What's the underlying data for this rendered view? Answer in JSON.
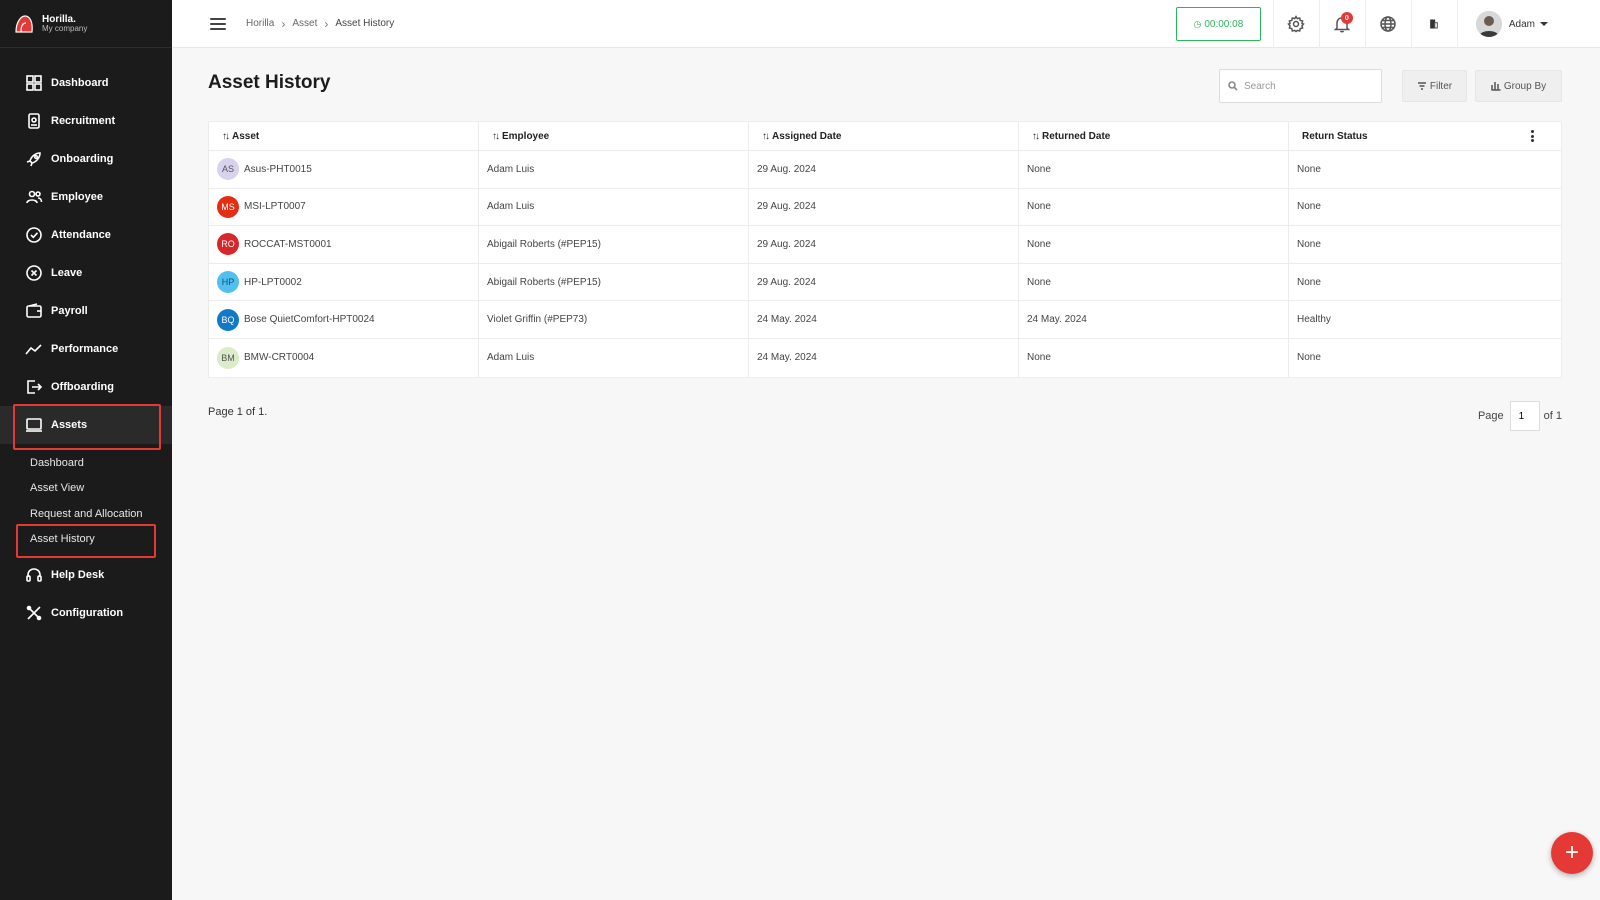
{
  "brand": {
    "name": "Horilla.",
    "company": "My company"
  },
  "sidebar": {
    "items": [
      {
        "label": "Dashboard",
        "icon": "dashboard-icon"
      },
      {
        "label": "Recruitment",
        "icon": "recruitment-icon"
      },
      {
        "label": "Onboarding",
        "icon": "rocket-icon"
      },
      {
        "label": "Employee",
        "icon": "people-icon"
      },
      {
        "label": "Attendance",
        "icon": "check-circle-icon"
      },
      {
        "label": "Leave",
        "icon": "x-circle-icon"
      },
      {
        "label": "Payroll",
        "icon": "wallet-icon"
      },
      {
        "label": "Performance",
        "icon": "trend-icon"
      },
      {
        "label": "Offboarding",
        "icon": "exit-icon"
      },
      {
        "label": "Assets",
        "icon": "laptop-icon",
        "active": true
      }
    ],
    "assets_sub": [
      {
        "label": "Dashboard"
      },
      {
        "label": "Asset View"
      },
      {
        "label": "Request and Allocation"
      },
      {
        "label": "Asset History",
        "active": true
      }
    ],
    "bottom_items": [
      {
        "label": "Help Desk",
        "icon": "headset-icon"
      },
      {
        "label": "Configuration",
        "icon": "tools-icon"
      }
    ]
  },
  "topbar": {
    "breadcrumb": [
      "Horilla",
      "Asset",
      "Asset History"
    ],
    "timer": "00:00:08",
    "notification_count": "0",
    "user_name": "Adam"
  },
  "main": {
    "title": "Asset History",
    "search_placeholder": "Search",
    "filter_label": "Filter",
    "group_by_label": "Group By",
    "columns": [
      "Asset",
      "Employee",
      "Assigned Date",
      "Returned Date",
      "Return Status"
    ],
    "rows": [
      {
        "initials": "AS",
        "avatar_bg": "#d9d2ee",
        "avatar_fg": "#555",
        "asset": "Asus-PHT0015",
        "employee": "Adam Luis",
        "assigned": "29 Aug. 2024",
        "returned": "None",
        "status": "None"
      },
      {
        "initials": "MS",
        "avatar_bg": "#e52d12",
        "avatar_fg": "#fff",
        "asset": "MSI-LPT0007",
        "employee": "Adam Luis",
        "assigned": "29 Aug. 2024",
        "returned": "None",
        "status": "None"
      },
      {
        "initials": "RO",
        "avatar_bg": "#d8262b",
        "avatar_fg": "#fff",
        "asset": "ROCCAT-MST0001",
        "employee": "Abigail Roberts (#PEP15)",
        "assigned": "29 Aug. 2024",
        "returned": "None",
        "status": "None"
      },
      {
        "initials": "HP",
        "avatar_bg": "#4fc0ef",
        "avatar_fg": "#1a4f6b",
        "asset": "HP-LPT0002",
        "employee": "Abigail Roberts (#PEP15)",
        "assigned": "29 Aug. 2024",
        "returned": "None",
        "status": "None"
      },
      {
        "initials": "BQ",
        "avatar_bg": "#1279c9",
        "avatar_fg": "#fff",
        "asset": "Bose QuietComfort-HPT0024",
        "employee": "Violet Griffin (#PEP73)",
        "assigned": "24 May. 2024",
        "returned": "24 May. 2024",
        "status": "Healthy"
      },
      {
        "initials": "BM",
        "avatar_bg": "#dcebc8",
        "avatar_fg": "#555",
        "asset": "BMW-CRT0004",
        "employee": "Adam Luis",
        "assigned": "24 May. 2024",
        "returned": "None",
        "status": "None"
      }
    ],
    "pager_text": "Page 1 of 1.",
    "pager_label": "Page",
    "pager_value": "1",
    "pager_of": "of 1"
  },
  "fab_label": "+"
}
